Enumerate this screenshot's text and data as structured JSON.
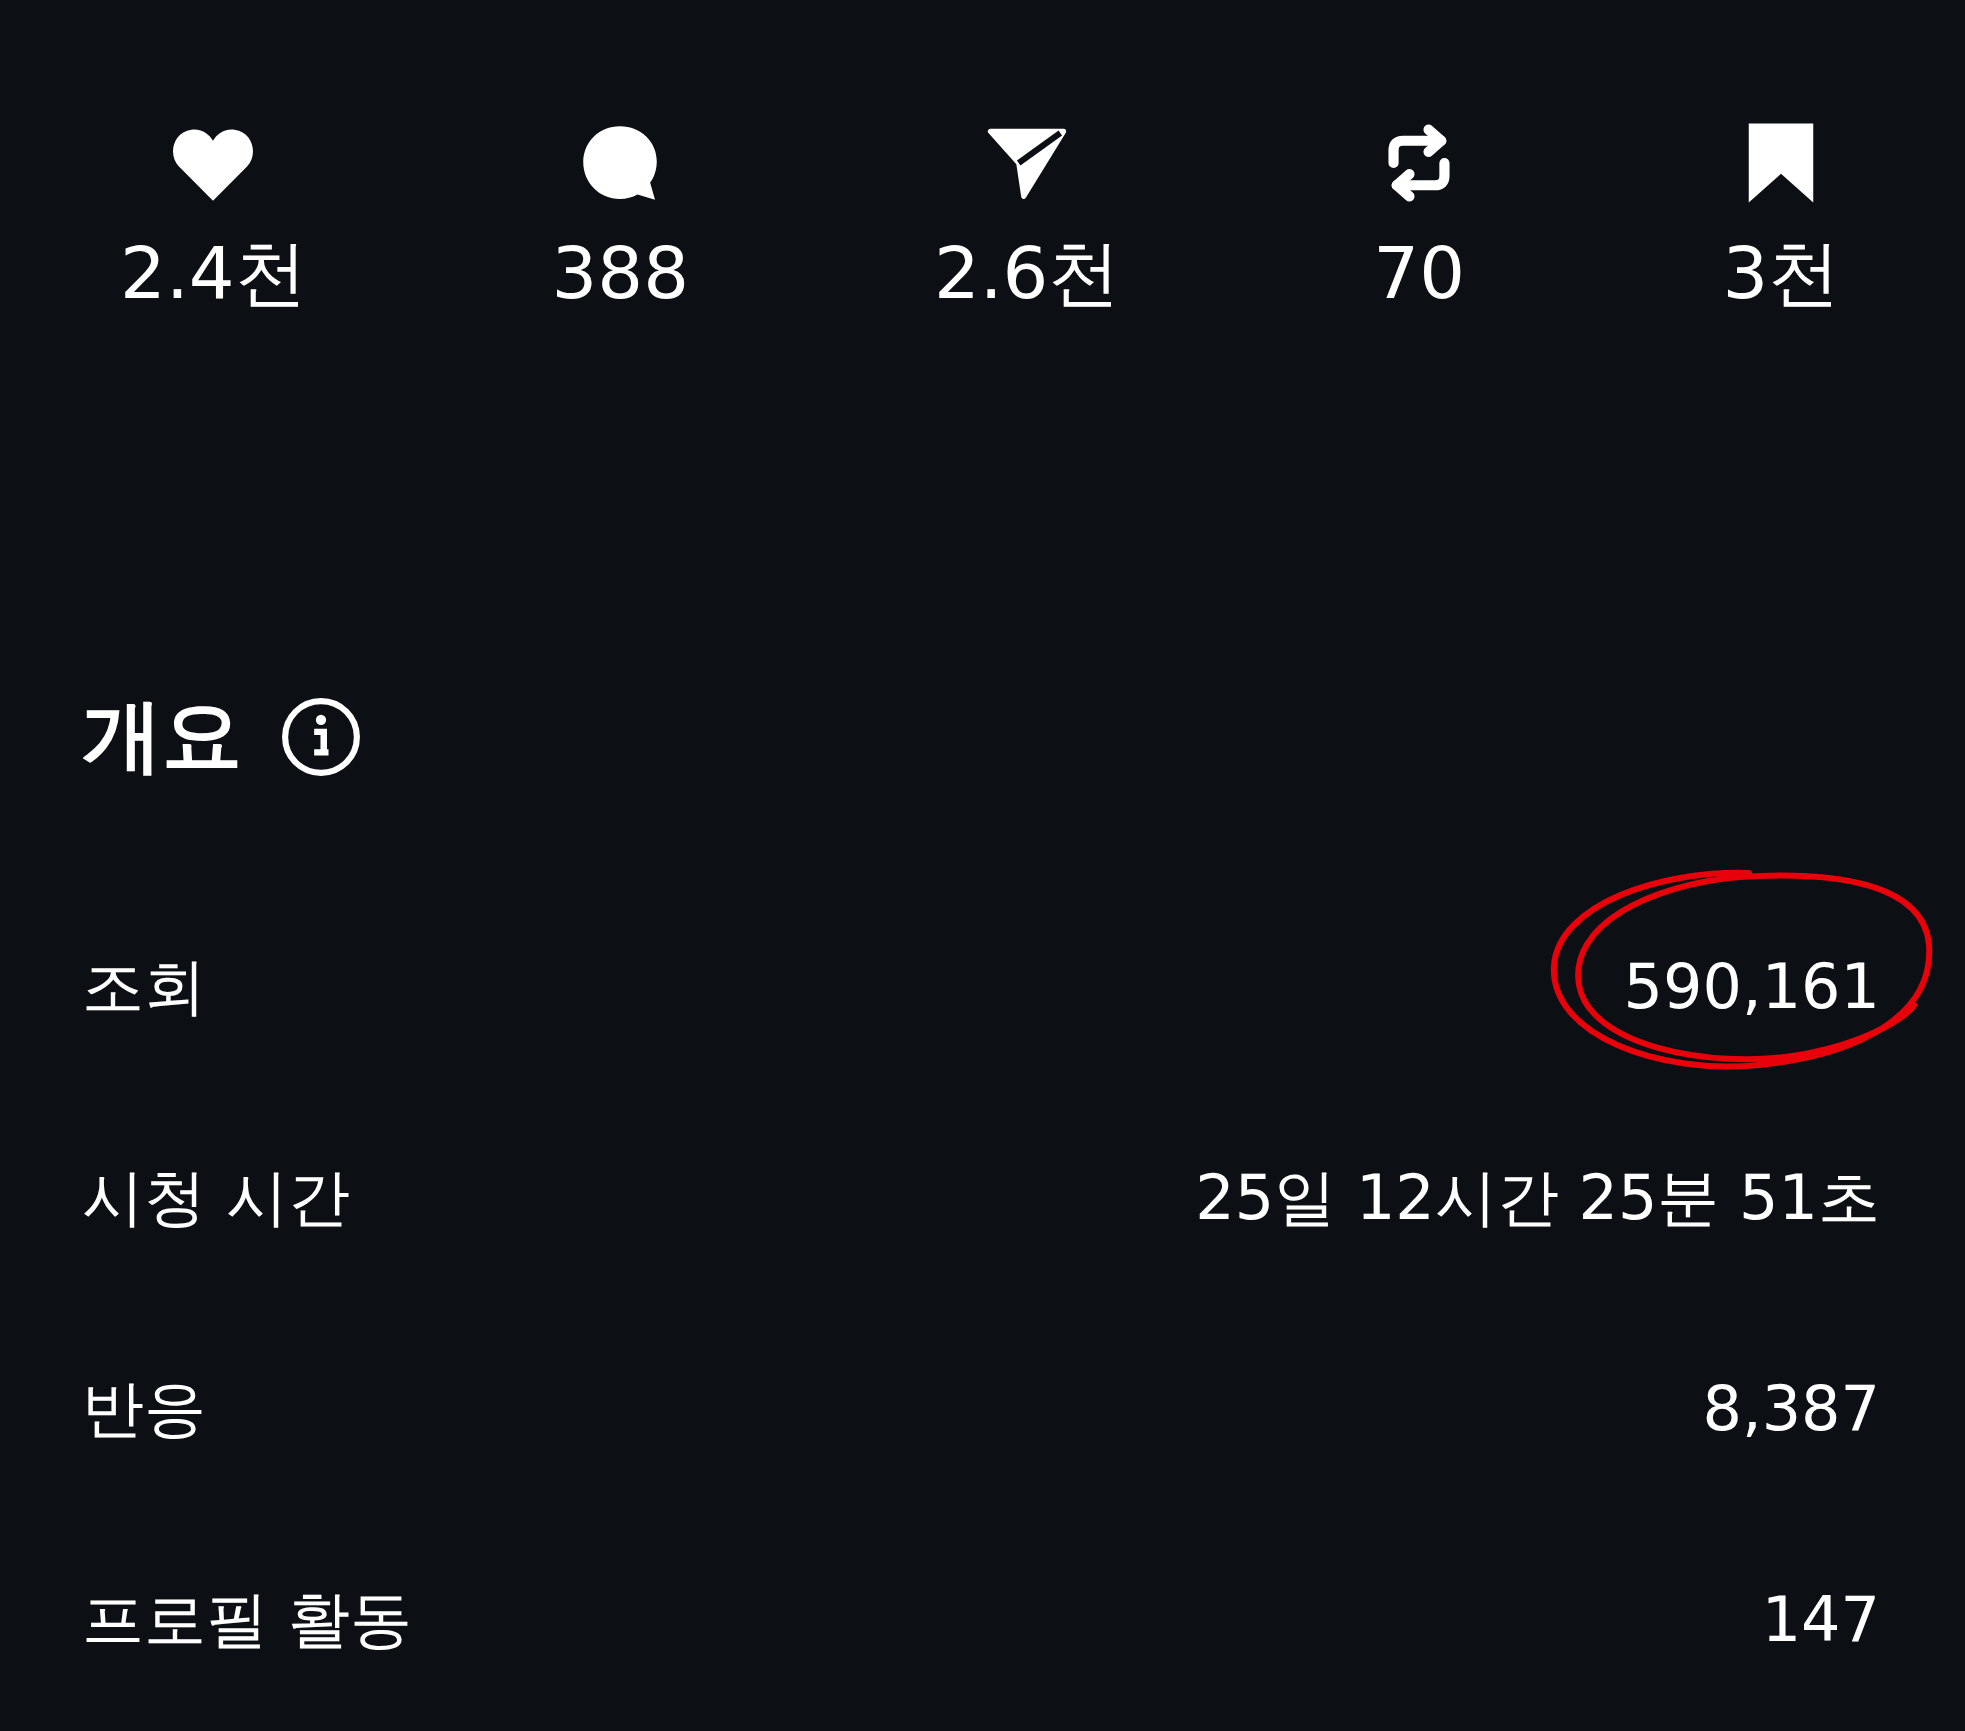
{
  "stats": [
    {
      "kind": "like",
      "count": "2.4천"
    },
    {
      "kind": "comment",
      "count": "388"
    },
    {
      "kind": "share",
      "count": "2.6천"
    },
    {
      "kind": "repost",
      "count": "70"
    },
    {
      "kind": "save",
      "count": "3천"
    }
  ],
  "overview": {
    "title": "개요",
    "rows": [
      {
        "label": "조회",
        "value": "590,161",
        "circled": true
      },
      {
        "label": "시청 시간",
        "value": "25일 12시간 25분 51초",
        "circled": false
      },
      {
        "label": "반응",
        "value": "8,387",
        "circled": false
      },
      {
        "label": "프로필 활동",
        "value": "147",
        "circled": false
      }
    ]
  }
}
